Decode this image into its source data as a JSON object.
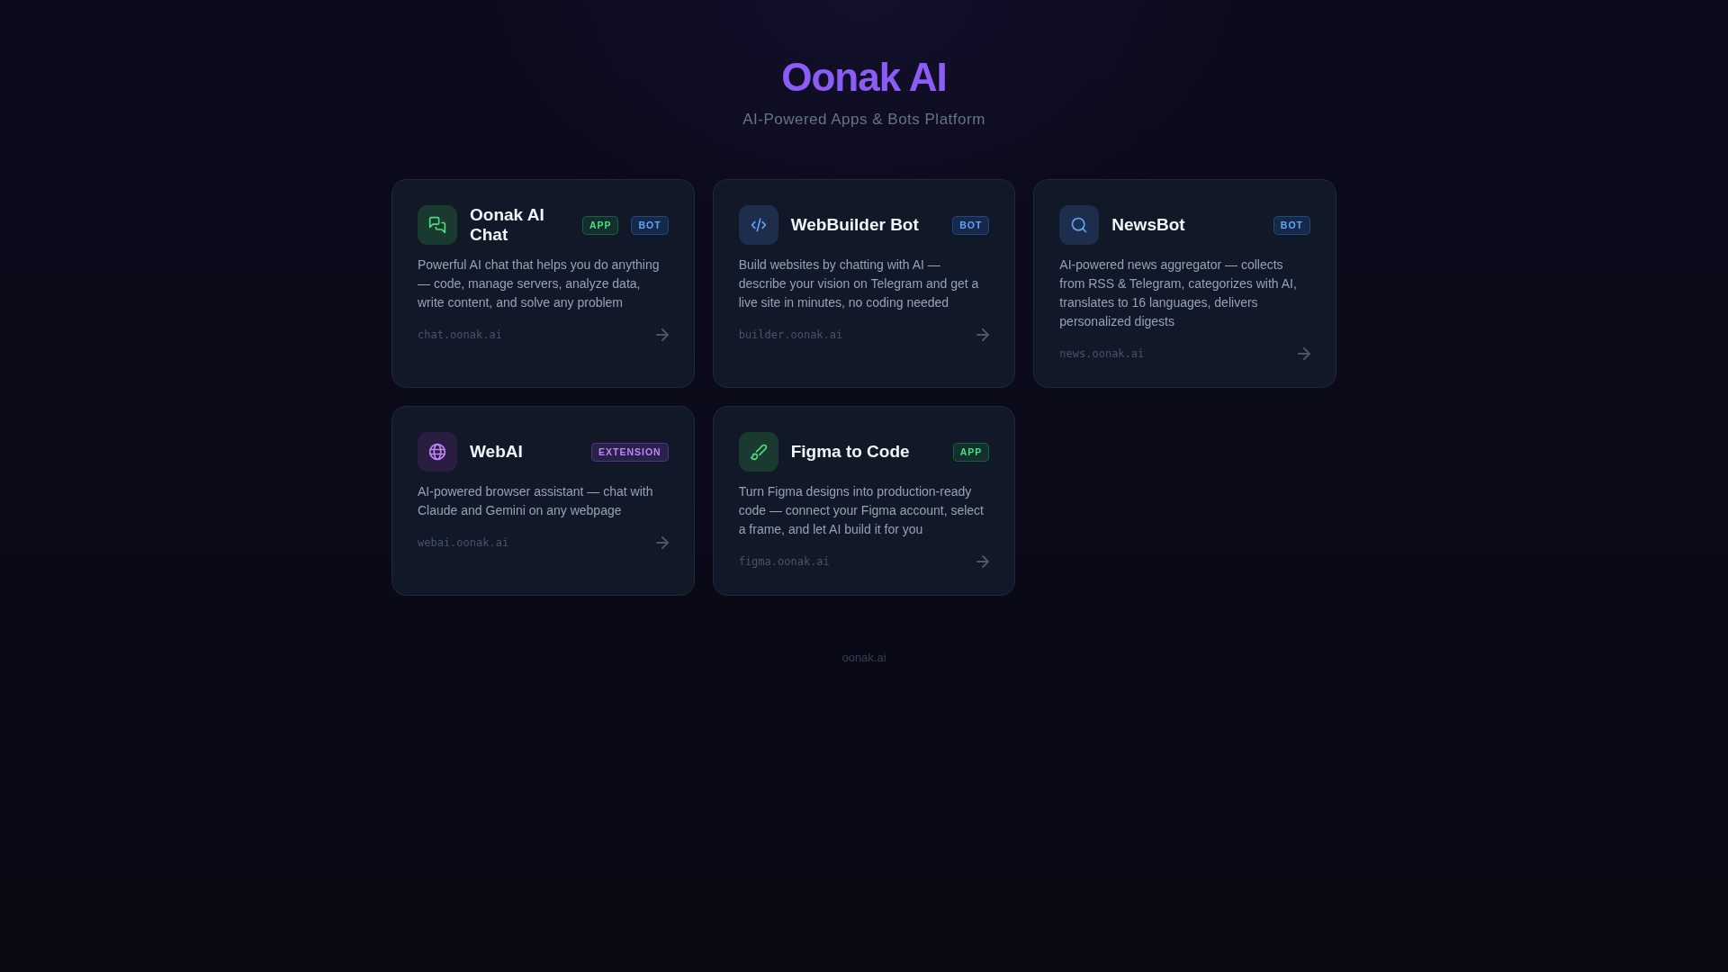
{
  "header": {
    "title": "Oonak AI",
    "subtitle": "AI-Powered Apps & Bots Platform"
  },
  "cards": [
    {
      "kind": "chat",
      "title": "Oonak AI Chat",
      "badges": [
        {
          "kind": "app",
          "label": "APP"
        },
        {
          "kind": "bot",
          "label": "BOT"
        }
      ],
      "description": "Powerful AI chat that helps you do anything — code, manage servers, analyze data, write content, and solve any problem",
      "url": "chat.oonak.ai"
    },
    {
      "kind": "code",
      "title": "WebBuilder Bot",
      "badges": [
        {
          "kind": "bot",
          "label": "BOT"
        }
      ],
      "description": "Build websites by chatting with AI — describe your vision on Telegram and get a live site in minutes, no coding needed",
      "url": "builder.oonak.ai"
    },
    {
      "kind": "search",
      "title": "NewsBot",
      "badges": [
        {
          "kind": "bot",
          "label": "BOT"
        }
      ],
      "description": "AI-powered news aggregator — collects from RSS & Telegram, categorizes with AI, translates to 16 languages, delivers personalized digests",
      "url": "news.oonak.ai"
    },
    {
      "kind": "globe",
      "title": "WebAI",
      "badges": [
        {
          "kind": "extension",
          "label": "EXTENSION"
        }
      ],
      "description": "AI-powered browser assistant — chat with Claude and Gemini on any webpage",
      "url": "webai.oonak.ai"
    },
    {
      "kind": "brush",
      "title": "Figma to Code",
      "badges": [
        {
          "kind": "app",
          "label": "APP"
        }
      ],
      "description": "Turn Figma designs into production-ready code — connect your Figma account, select a frame, and let AI build it for you",
      "url": "figma.oonak.ai"
    }
  ],
  "footer": "oonak.ai"
}
